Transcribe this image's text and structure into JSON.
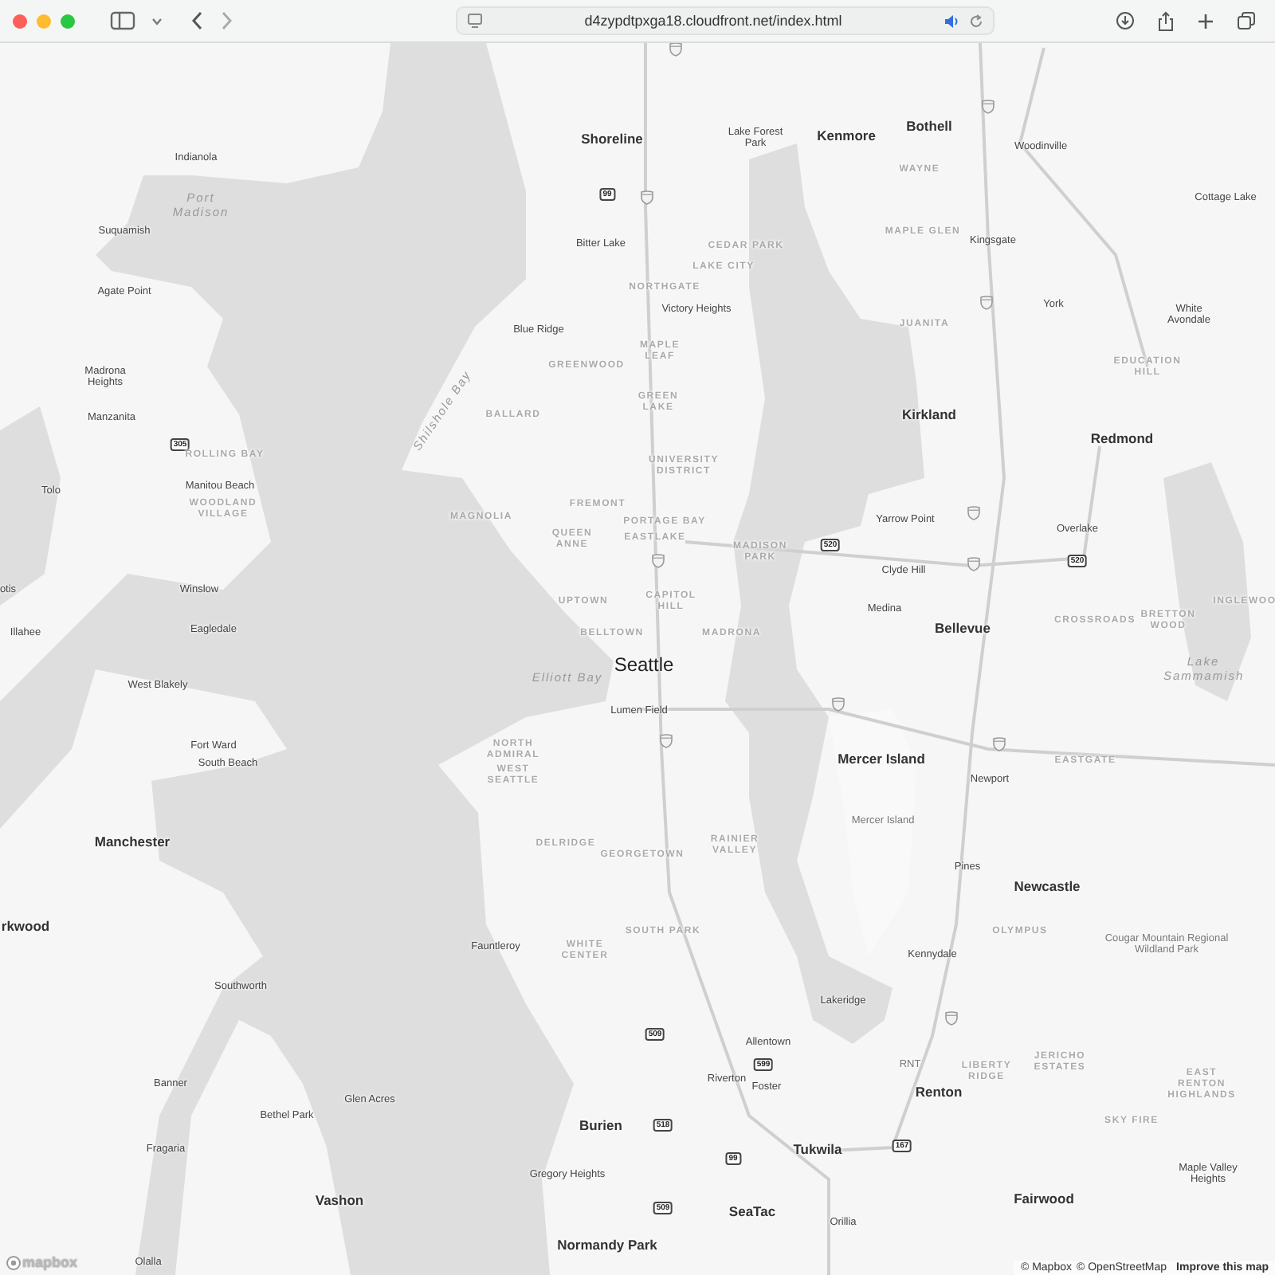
{
  "browser": {
    "url": "d4zypdtpxga18.cloudfront.net/index.html"
  },
  "map": {
    "labels": [
      {
        "kind": "city",
        "text": "Shoreline"
      },
      {
        "kind": "town",
        "text": "Lake Forest Park"
      },
      {
        "kind": "city",
        "text": "Kenmore"
      },
      {
        "kind": "city",
        "text": "Bothell"
      },
      {
        "kind": "town",
        "text": "Woodinville"
      },
      {
        "kind": "town",
        "text": "Indianola"
      },
      {
        "kind": "hood",
        "text": "WAYNE"
      },
      {
        "kind": "town",
        "text": "Cottage Lake"
      },
      {
        "kind": "water",
        "text": "Port Madison"
      },
      {
        "kind": "town",
        "text": "Suquamish"
      },
      {
        "kind": "town",
        "text": "Bitter Lake"
      },
      {
        "kind": "hood",
        "text": "CEDAR PARK"
      },
      {
        "kind": "hood",
        "text": "MAPLE GLEN"
      },
      {
        "kind": "town",
        "text": "Kingsgate"
      },
      {
        "kind": "hood",
        "text": "LAKE CITY"
      },
      {
        "kind": "town",
        "text": "Agate Point"
      },
      {
        "kind": "hood",
        "text": "NORTHGATE"
      },
      {
        "kind": "town",
        "text": "Victory Heights"
      },
      {
        "kind": "town",
        "text": "York"
      },
      {
        "kind": "town",
        "text": "White Avondale"
      },
      {
        "kind": "town",
        "text": "Blue Ridge"
      },
      {
        "kind": "hood",
        "text": "JUANITA"
      },
      {
        "kind": "hood",
        "text": "MAPLE LEAF"
      },
      {
        "kind": "town",
        "text": "Madrona Heights"
      },
      {
        "kind": "hood",
        "text": "GREENWOOD"
      },
      {
        "kind": "hood",
        "text": "EDUCATION HILL"
      },
      {
        "kind": "town",
        "text": "Manzanita"
      },
      {
        "kind": "water",
        "text": "Shilshole Bay"
      },
      {
        "kind": "hood",
        "text": "BALLARD"
      },
      {
        "kind": "hood",
        "text": "GREEN LAKE"
      },
      {
        "kind": "city",
        "text": "Kirkland"
      },
      {
        "kind": "city",
        "text": "Redmond"
      },
      {
        "kind": "hood",
        "text": "ROLLING BAY"
      },
      {
        "kind": "hood",
        "text": "UNIVERSITY DISTRICT"
      },
      {
        "kind": "town",
        "text": "Tolo"
      },
      {
        "kind": "town",
        "text": "Manitou Beach"
      },
      {
        "kind": "hood",
        "text": "WOODLAND VILLAGE"
      },
      {
        "kind": "hood",
        "text": "FREMONT"
      },
      {
        "kind": "hood",
        "text": "MAGNOLIA"
      },
      {
        "kind": "hood",
        "text": "PORTAGE BAY"
      },
      {
        "kind": "town",
        "text": "Yarrow Point"
      },
      {
        "kind": "hood",
        "text": "QUEEN ANNE"
      },
      {
        "kind": "hood",
        "text": "EASTLAKE"
      },
      {
        "kind": "town",
        "text": "Overlake"
      },
      {
        "kind": "hood",
        "text": "MADISON PARK"
      },
      {
        "kind": "town",
        "text": "Clyde Hill"
      },
      {
        "kind": "town",
        "text": "otis"
      },
      {
        "kind": "town",
        "text": "Winslow"
      },
      {
        "kind": "hood",
        "text": "UPTOWN"
      },
      {
        "kind": "hood",
        "text": "CAPITOL HILL"
      },
      {
        "kind": "town",
        "text": "Medina"
      },
      {
        "kind": "hood",
        "text": "INGLEWOO"
      },
      {
        "kind": "town",
        "text": "Illahee"
      },
      {
        "kind": "town",
        "text": "Eagledale"
      },
      {
        "kind": "hood",
        "text": "BELLTOWN"
      },
      {
        "kind": "hood",
        "text": "MADRONA"
      },
      {
        "kind": "city",
        "text": "Bellevue"
      },
      {
        "kind": "hood",
        "text": "CROSSROADS"
      },
      {
        "kind": "hood",
        "text": "BRETTON WOOD"
      },
      {
        "kind": "water",
        "text": "Elliott Bay"
      },
      {
        "kind": "major",
        "text": "Seattle"
      },
      {
        "kind": "water",
        "text": "Lake Sammamish"
      },
      {
        "kind": "town",
        "text": "West Blakely"
      },
      {
        "kind": "town",
        "text": "Lumen Field"
      },
      {
        "kind": "town",
        "text": "Fort Ward"
      },
      {
        "kind": "town",
        "text": "South Beach"
      },
      {
        "kind": "hood",
        "text": "NORTH ADMIRAL"
      },
      {
        "kind": "city",
        "text": "Mercer Island"
      },
      {
        "kind": "hood",
        "text": "EASTGATE"
      },
      {
        "kind": "hood",
        "text": "WEST SEATTLE"
      },
      {
        "kind": "town",
        "text": "Newport"
      },
      {
        "kind": "place",
        "text": "Mercer Island"
      },
      {
        "kind": "city",
        "text": "Manchester"
      },
      {
        "kind": "hood",
        "text": "DELRIDGE"
      },
      {
        "kind": "hood",
        "text": "GEORGETOWN"
      },
      {
        "kind": "hood",
        "text": "RAINIER VALLEY"
      },
      {
        "kind": "town",
        "text": "Pines"
      },
      {
        "kind": "city",
        "text": "Newcastle"
      },
      {
        "kind": "city",
        "text": "rkwood"
      },
      {
        "kind": "hood",
        "text": "SOUTH PARK"
      },
      {
        "kind": "hood",
        "text": "OLYMPUS"
      },
      {
        "kind": "town",
        "text": "Fauntleroy"
      },
      {
        "kind": "hood",
        "text": "WHITE CENTER"
      },
      {
        "kind": "town",
        "text": "Kennydale"
      },
      {
        "kind": "place",
        "text": "Cougar Mountain Regional Wildland Park"
      },
      {
        "kind": "town",
        "text": "Southworth"
      },
      {
        "kind": "town",
        "text": "Lakeridge"
      },
      {
        "kind": "town",
        "text": "Allentown"
      },
      {
        "kind": "town",
        "text": "Banner"
      },
      {
        "kind": "town",
        "text": "Riverton"
      },
      {
        "kind": "town",
        "text": "Foster"
      },
      {
        "kind": "place",
        "text": "RNT"
      },
      {
        "kind": "city",
        "text": "Renton"
      },
      {
        "kind": "hood",
        "text": "LIBERTY RIDGE"
      },
      {
        "kind": "hood",
        "text": "JERICHO ESTATES"
      },
      {
        "kind": "hood",
        "text": "EAST RENTON HIGHLANDS"
      },
      {
        "kind": "town",
        "text": "Glen Acres"
      },
      {
        "kind": "town",
        "text": "Bethel Park"
      },
      {
        "kind": "city",
        "text": "Burien"
      },
      {
        "kind": "hood",
        "text": "SKY FIRE"
      },
      {
        "kind": "town",
        "text": "Fragaria"
      },
      {
        "kind": "city",
        "text": "Tukwila"
      },
      {
        "kind": "town",
        "text": "Gregory Heights"
      },
      {
        "kind": "town",
        "text": "Maple Valley Heights"
      },
      {
        "kind": "city",
        "text": "Vashon"
      },
      {
        "kind": "city",
        "text": "Fairwood"
      },
      {
        "kind": "city",
        "text": "SeaTac"
      },
      {
        "kind": "town",
        "text": "Orillia"
      },
      {
        "kind": "city",
        "text": "Normandy Park"
      },
      {
        "kind": "town",
        "text": "Olalla"
      }
    ],
    "shields": [
      {
        "text": "99"
      },
      {
        "text": "305"
      },
      {
        "text": "520"
      },
      {
        "text": "520"
      },
      {
        "text": "509"
      },
      {
        "text": "599"
      },
      {
        "text": "518"
      },
      {
        "text": "99"
      },
      {
        "text": "167"
      },
      {
        "text": "509"
      }
    ],
    "logo": "mapbox",
    "attribution": [
      "© Mapbox",
      "© OpenStreetMap",
      "Improve this map"
    ]
  }
}
